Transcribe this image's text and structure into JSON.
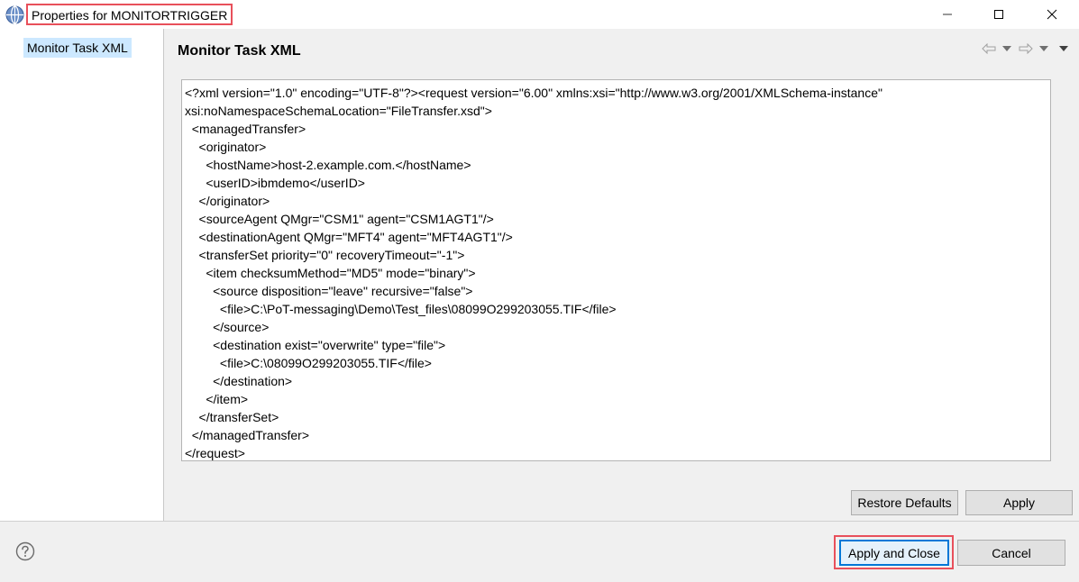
{
  "window": {
    "title": "Properties for MONITORTRIGGER"
  },
  "tree": {
    "items": [
      {
        "label": "Monitor Task XML",
        "selected": true
      }
    ]
  },
  "page": {
    "title": "Monitor Task XML",
    "xml_lines": [
      "<?xml version=\"1.0\" encoding=\"UTF-8\"?><request version=\"6.00\" xmlns:xsi=\"http://www.w3.org/2001/XMLSchema-instance\"",
      "xsi:noNamespaceSchemaLocation=\"FileTransfer.xsd\">",
      "  <managedTransfer>",
      "    <originator>",
      "      <hostName>host-2.example.com.</hostName>",
      "      <userID>ibmdemo</userID>",
      "    </originator>",
      "    <sourceAgent QMgr=\"CSM1\" agent=\"CSM1AGT1\"/>",
      "    <destinationAgent QMgr=\"MFT4\" agent=\"MFT4AGT1\"/>",
      "    <transferSet priority=\"0\" recoveryTimeout=\"-1\">",
      "      <item checksumMethod=\"MD5\" mode=\"binary\">",
      "        <source disposition=\"leave\" recursive=\"false\">",
      "          <file>C:\\PoT-messaging\\Demo\\Test_files\\08099O299203055.TIF</file>",
      "        </source>",
      "        <destination exist=\"overwrite\" type=\"file\">",
      "          <file>C:\\08099O299203055.TIF</file>",
      "        </destination>",
      "      </item>",
      "    </transferSet>",
      "  </managedTransfer>",
      "</request>"
    ],
    "restore_defaults_label": "Restore Defaults",
    "apply_label": "Apply"
  },
  "footer": {
    "apply_close_label": "Apply and Close",
    "cancel_label": "Cancel"
  },
  "colors": {
    "highlight": "#e8505b",
    "selection": "#cce8ff",
    "focus": "#0078d7"
  },
  "icons": [
    "app-globe-icon",
    "minimize-icon",
    "maximize-icon",
    "close-icon",
    "back-arrow-icon",
    "forward-arrow-icon",
    "chevron-down-icon",
    "view-menu-icon",
    "help-icon"
  ]
}
